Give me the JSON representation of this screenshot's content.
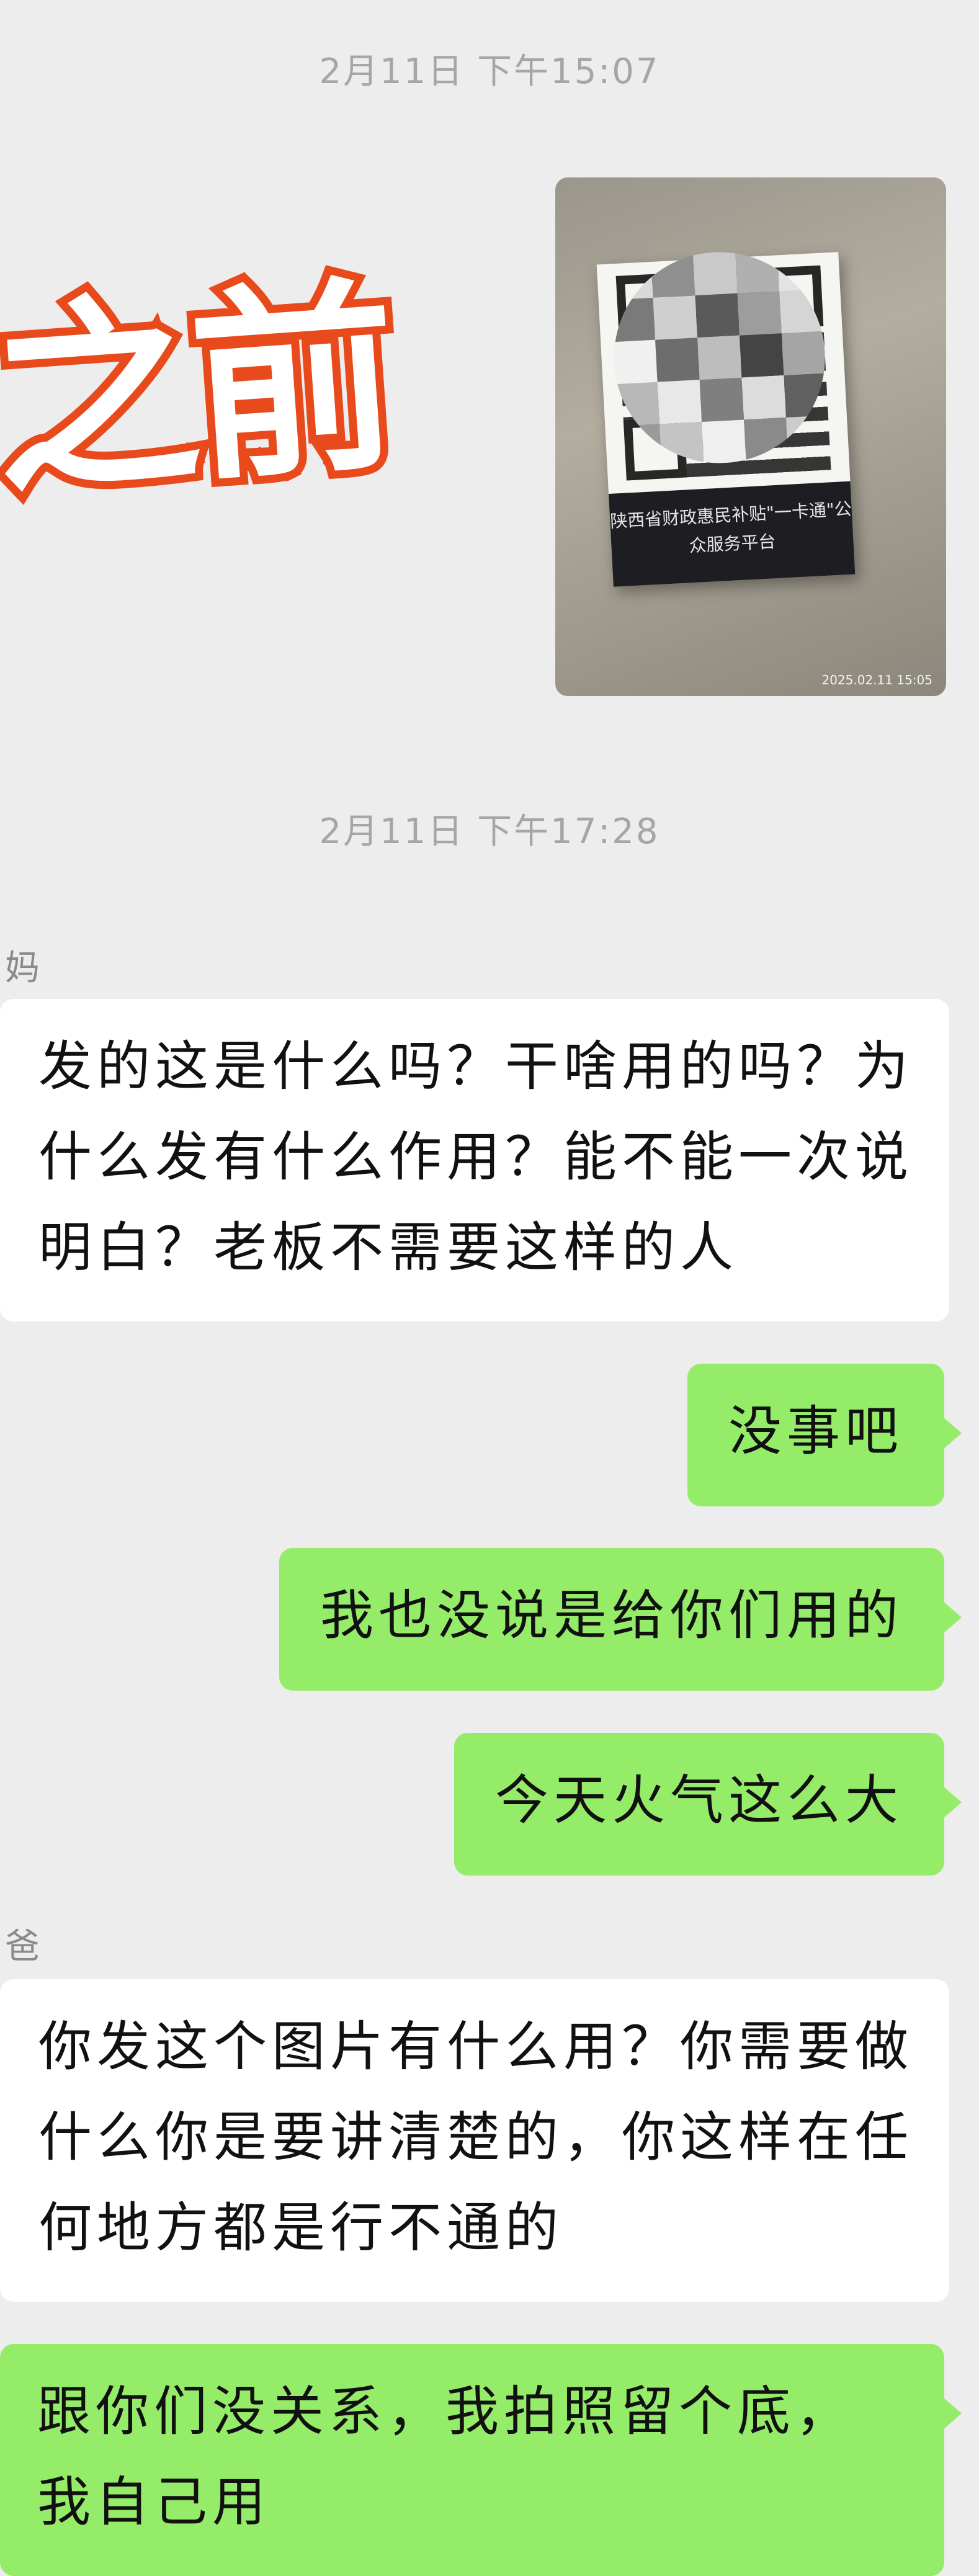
{
  "timestamps": [
    "2月11日 下午15:07",
    "2月11日 下午17:28"
  ],
  "overlay_text": "之前",
  "photo": {
    "caption": "陕西省财政惠民补贴\"一卡通\"公众服务平台",
    "stamp": "2025.02.11 15:05"
  },
  "messages": [
    {
      "sender": "妈",
      "text": "发的这是什么吗？干啥用的吗？为什么发有什么作用？能不能一次说明白？老板不需要这样的人"
    },
    {
      "text": "没事吧"
    },
    {
      "text": "我也没说是给你们用的"
    },
    {
      "text": "今天火气这么大"
    },
    {
      "sender": "爸",
      "text": "你发这个图片有什么用？你需要做什么你是要讲清楚的，你这样在任何地方都是行不通的"
    },
    {
      "text": "跟你们没关系，我拍照留个底，我自己用"
    }
  ],
  "colors": {
    "outgoing": "#95ec69",
    "incoming": "#ffffff",
    "background": "#ededed",
    "overlay_stroke": "#e84a1c"
  }
}
